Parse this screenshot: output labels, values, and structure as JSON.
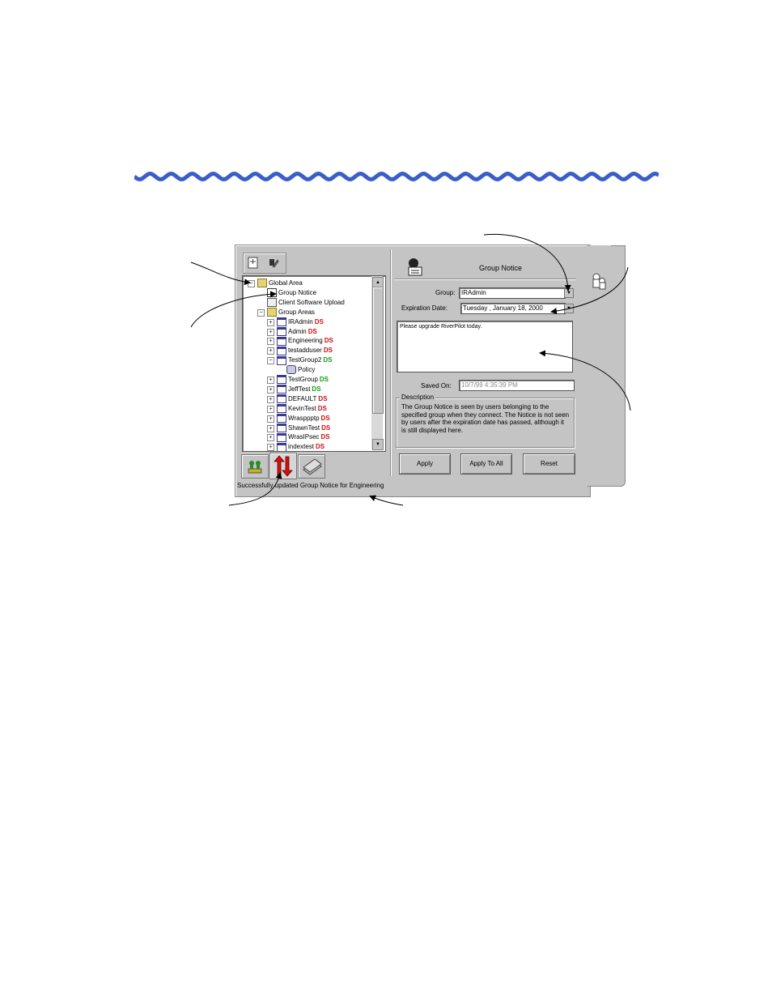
{
  "tree": {
    "items": [
      {
        "label": "Global Area",
        "badge": ""
      },
      {
        "label": "Group Notice",
        "badge": ""
      },
      {
        "label": "Client Software Upload",
        "badge": ""
      },
      {
        "label": "Group Areas",
        "badge": ""
      },
      {
        "label": "IRAdmin",
        "badge": "DS"
      },
      {
        "label": "Admin",
        "badge": "DS"
      },
      {
        "label": "Engineering",
        "badge": "DS"
      },
      {
        "label": "testadduser",
        "badge": "DS"
      },
      {
        "label": "TestGroup2",
        "badge": "DS"
      },
      {
        "label": "Policy",
        "badge": ""
      },
      {
        "label": "TestGroup",
        "badge": "DS"
      },
      {
        "label": "JeffTest",
        "badge": "DS"
      },
      {
        "label": "DEFAULT",
        "badge": "DS"
      },
      {
        "label": "KevinTest",
        "badge": "DS"
      },
      {
        "label": "Wrasppptp",
        "badge": "DS"
      },
      {
        "label": "ShawnTest",
        "badge": "DS"
      },
      {
        "label": "WrasIPsec",
        "badge": "DS"
      },
      {
        "label": "indextest",
        "badge": "DS"
      }
    ]
  },
  "panel": {
    "title": "Group Notice",
    "group_label": "Group:",
    "group_value": "IRAdmin",
    "expiration_label": "Expiration Date:",
    "expiration_value": "Tuesday  ,  January  18, 2000",
    "notice_text": "Please upgrade RiverPilot today.",
    "saved_on_label": "Saved On:",
    "saved_on_value": "10/7/99 4:35:39 PM",
    "description_title": "Description",
    "description_text": "The Group Notice is seen by users belonging to the specified group when they connect. The Notice is not seen by users after the expiration date has passed, although it is still displayed here."
  },
  "buttons": {
    "apply": "Apply",
    "apply_all": "Apply To All",
    "reset": "Reset"
  },
  "status_text": "Successfully updated Group Notice for Engineering",
  "colors": {
    "wave": "#3a5ec8",
    "badge_red": "#d01010",
    "badge_green": "#10a010",
    "panel_bg": "#c4c4c4"
  }
}
